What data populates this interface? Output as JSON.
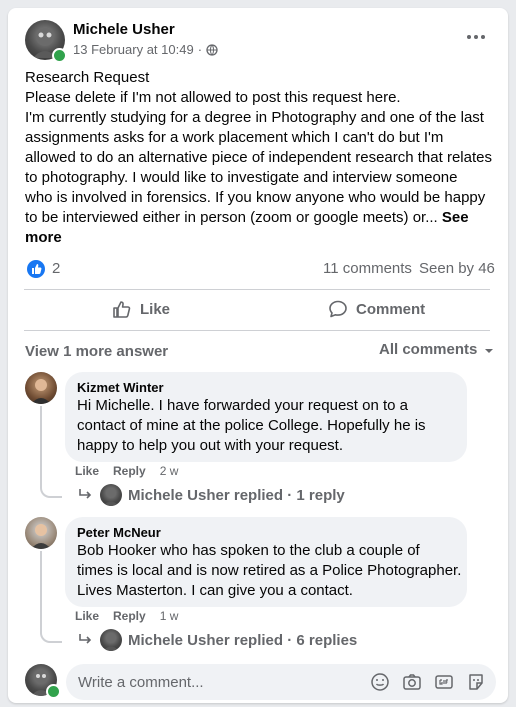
{
  "post": {
    "author": "Michele Usher",
    "date": "13 February at 10:49",
    "privacy_sep": "·",
    "body_lines": [
      "Research Request",
      "Please delete if I'm not allowed to post this request here.",
      "I'm currently studying for a degree in Photography and one of the last",
      "assignments asks for a work placement which I can't do but I'm",
      "allowed to do an alternative piece of independent research that relates",
      "to photography.   I would like to investigate and interview someone",
      "who is involved in forensics.  If you know anyone who would be happy",
      "to be interviewed either in person (zoom or google meets) or..."
    ],
    "see_more": "See more",
    "see_more_wrap": "more",
    "reaction_count": "2",
    "comments_count": "11 comments",
    "seen_by": "Seen by 46"
  },
  "actions": {
    "like": "Like",
    "comment": "Comment"
  },
  "comments_header": {
    "view_more": "View 1 more answer",
    "sort": "All comments"
  },
  "comments": [
    {
      "author": "Kizmet Winter",
      "lines": [
        "Hi Michelle. I have forwarded your request on to a",
        "contact of mine at the police College. Hopefully he is",
        "happy to help you out with your request."
      ],
      "like": "Like",
      "reply": "Reply",
      "age": "2 w",
      "reply_summary": "Michele Usher replied · 1 reply"
    },
    {
      "author": "Peter McNeur",
      "lines": [
        "Bob Hooker who has spoken to the club a couple of",
        "times is local and is now retired as a Police Photographer.",
        "Lives Masterton. I can give you a contact."
      ],
      "like": "Like",
      "reply": "Reply",
      "age": "1 w",
      "reply_summary": "Michele Usher replied · 6 replies"
    }
  ],
  "composer": {
    "placeholder": "Write a comment..."
  },
  "colors": {
    "accent": "#1877f2",
    "online": "#31a24c",
    "muted": "#65676b"
  }
}
